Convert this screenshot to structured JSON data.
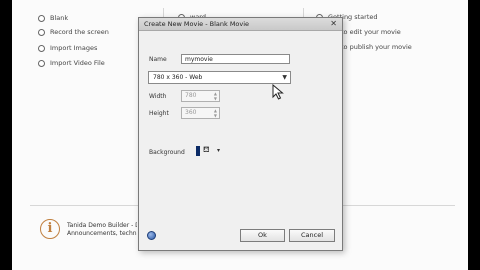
{
  "background": {
    "left_column": [
      "Blank",
      "Record the screen",
      "Import Images",
      "Import Video File"
    ],
    "middle_column": [
      "ward"
    ],
    "right_column": [
      "Getting started",
      "to edit your movie",
      "to publish your movie"
    ],
    "info_text_line1": "Tanida Demo Builder - D",
    "info_text_line2": "Announcements, techni"
  },
  "dialog": {
    "title": "Create New Movie - Blank Movie",
    "close_glyph": "✕",
    "name_label": "Name",
    "name_value": "mymovie",
    "size_selected": "780 x 360 - Web",
    "width_label": "Width",
    "width_value": "780",
    "height_label": "Height",
    "height_value": "360",
    "background_label": "Background",
    "ok_label": "Ok",
    "cancel_label": "Cancel"
  },
  "colors": {
    "background_swatch": "#0b2a66",
    "info_icon": "#c08040"
  },
  "icons": [
    "info-icon",
    "help-icon",
    "paint-bucket-icon",
    "dropdown-arrow-icon",
    "mouse-cursor-icon",
    "close-icon"
  ]
}
